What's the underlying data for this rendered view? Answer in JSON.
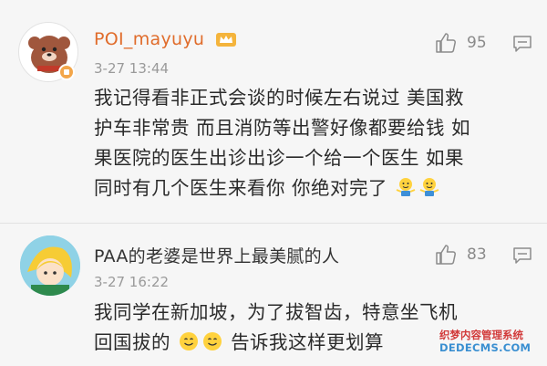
{
  "comments": [
    {
      "username": "POI_mayuyu",
      "time": "3-27 13:44",
      "likes": "95",
      "text_lines": [
        "我记得看非正式会谈的时候左右说过 美国救",
        "护车非常贵 而且消防等出警好像都要给钱 如",
        "果医院的医生出诊出诊一个给一个医生 如果",
        "同时有几个医生来看你 你绝对完了"
      ],
      "username_color": "#e06c2b"
    },
    {
      "username": "PAA的老婆是世界上最美腻的人",
      "time": "3-27 16:22",
      "likes": "83",
      "text_line1": "我同学在新加坡，为了拔智齿，特意坐飞机",
      "text_line2_a": "回国拔的",
      "text_line2_b": "告诉我这样更划算"
    }
  ],
  "icons": {
    "like": "thumb-up-icon",
    "reply": "comment-icon",
    "vip": "crown-icon",
    "emoji_shrug": "shrug-emoji-icon",
    "emoji_smile": "smile-emoji-icon"
  },
  "watermark": {
    "line1": "织梦内容管理系统",
    "line2": "DEDECMS.COM"
  }
}
